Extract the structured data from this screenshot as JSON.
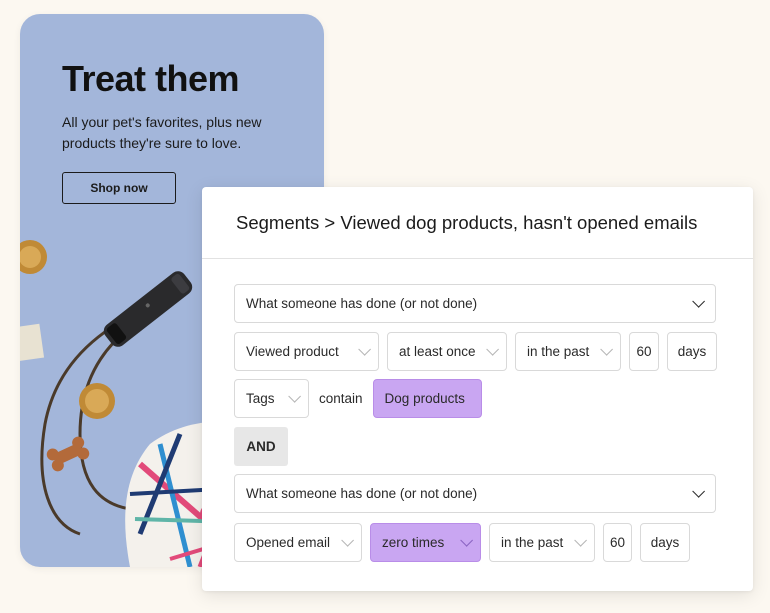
{
  "promo": {
    "title": "Treat them",
    "subtitle": "All your pet's favorites, plus new products they're sure to love.",
    "shop_label": "Shop now",
    "bg_color": "#a3b6da"
  },
  "segment": {
    "breadcrumb": "Segments > Viewed dog products, hasn't opened emails",
    "condition1": {
      "type": "What someone has done (or not done)",
      "action": "Viewed product",
      "frequency": "at least once",
      "timeframe": "in the past",
      "amount": "60",
      "unit": "days"
    },
    "filter": {
      "field": "Tags",
      "operator": "contain",
      "value": "Dog products"
    },
    "joiner": "AND",
    "condition2": {
      "type": "What someone has done (or not done)",
      "action": "Opened email",
      "frequency": "zero times",
      "timeframe": "in the past",
      "amount": "60",
      "unit": "days"
    },
    "highlight_color": "#c9a6f2"
  }
}
